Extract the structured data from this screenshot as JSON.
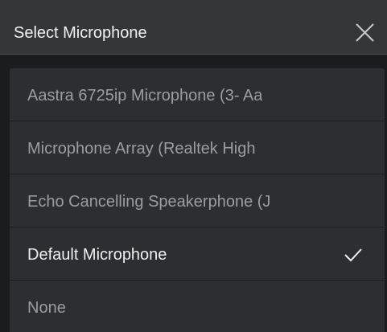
{
  "dialog": {
    "title": "Select Microphone",
    "close_icon": "close-icon"
  },
  "microphones": [
    {
      "label": "Aastra 6725ip Microphone (3- Aa",
      "selected": false
    },
    {
      "label": "Microphone Array (Realtek High",
      "selected": false
    },
    {
      "label": "Echo Cancelling Speakerphone (J",
      "selected": false
    },
    {
      "label": "Default Microphone",
      "selected": true,
      "indicator": "checkmark-icon"
    },
    {
      "label": "None",
      "selected": false
    }
  ],
  "colors": {
    "header_bg": "#343638",
    "list_bg": "#2c2e31",
    "page_bg": "#1b1c1e",
    "selected_text": "#f0f0f0",
    "unselected_text": "#9a9da2"
  }
}
